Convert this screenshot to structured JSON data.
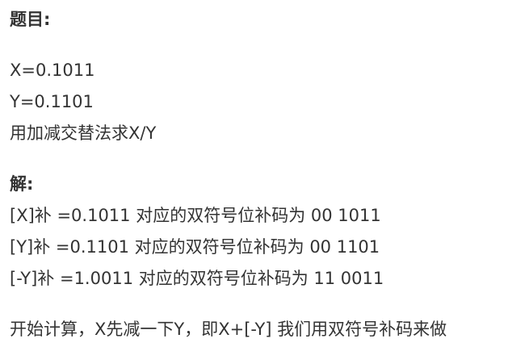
{
  "heading_problem": "题目:",
  "problem": {
    "line1": "X=0.1011",
    "line2": "Y=0.1101",
    "line3": "用加减交替法求X/Y"
  },
  "heading_solution": "解:",
  "solution": {
    "line1": "[X]补 =0.1011 对应的双符号位补码为 00 1011",
    "line2": "[Y]补 =0.1101 对应的双符号位补码为 00 1101",
    "line3": "[-Y]补 =1.0011 对应的双符号位补码为 11 0011"
  },
  "final_line": "开始计算，X先减一下Y，即X+[-Y] 我们用双符号补码来做"
}
